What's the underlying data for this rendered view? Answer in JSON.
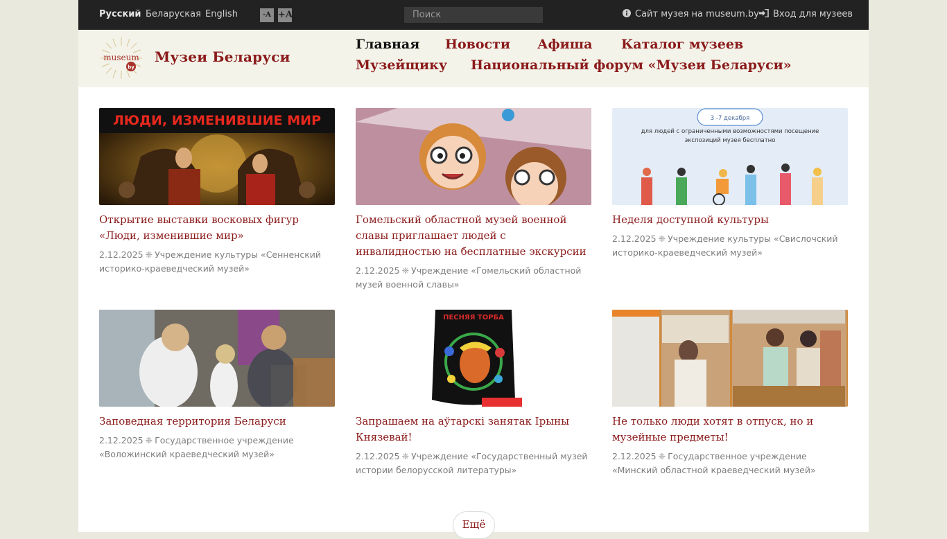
{
  "topbar": {
    "languages": [
      "Русский",
      "Беларуская",
      "English"
    ],
    "font_smaller": "-A",
    "font_larger": "+A",
    "search_placeholder": "Поиск",
    "museum_site_link": "Сайт музея на museum.by",
    "museum_login_link": "Вход для музеев"
  },
  "header": {
    "logo_text": "museum",
    "logo_badge": "by",
    "site_title": "Музеи Беларуси",
    "nav": [
      "Главная",
      "Новости",
      "Афиша",
      "Каталог музеев",
      "Музейщику",
      "Национальный форум «Музеи Беларуси»"
    ]
  },
  "cards": [
    {
      "title": "Открытие выставки восковых фигур «Люди, изменившие мир»",
      "date": "2.12.2025",
      "source": "Учреждение культуры «Сенненский историко-краеведческий музей»",
      "image_caption": "ЛЮДИ, ИЗМЕНИВШИЕ МИР"
    },
    {
      "title": "Гомельский областной музей военной славы приглашает людей с инвалидностью на бесплатные экскурсии",
      "date": "2.12.2025",
      "source": "Учреждение «Гомельский областной музей военной славы»",
      "image_caption": ""
    },
    {
      "title": "Неделя доступной культуры",
      "date": "2.12.2025",
      "source": "Учреждение культуры «Свислочский историко-краеведческий музей»",
      "image_caption": "3 -7 декабря",
      "image_text": "для людей с ограниченными возможностями посещение экспозиций музея бесплатно"
    },
    {
      "title": "Заповедная территория Беларуси",
      "date": "2.12.2025",
      "source": "Государственное учреждение «Воложинский краеведческий музей»",
      "image_caption": ""
    },
    {
      "title": "Запрашаем на аўтарскі занятак Ірыны Князевай!",
      "date": "2.12.2025",
      "source": "Учреждение «Государственный музей истории белорусской литературы»",
      "image_caption": "ПЕСНЯЯ ТОРБА"
    },
    {
      "title": "Не только люди хотят в отпуск, но и музейные предметы!",
      "date": "2.12.2025",
      "source": "Государственное учреждение «Минский областной краеведческий музей»",
      "image_caption": ""
    }
  ],
  "more_button": "Ещё",
  "colors": {
    "accent": "#8b1a1a",
    "topbar": "#222222",
    "header_bg": "#f3f3e9",
    "page_bg": "#e9e9de"
  }
}
